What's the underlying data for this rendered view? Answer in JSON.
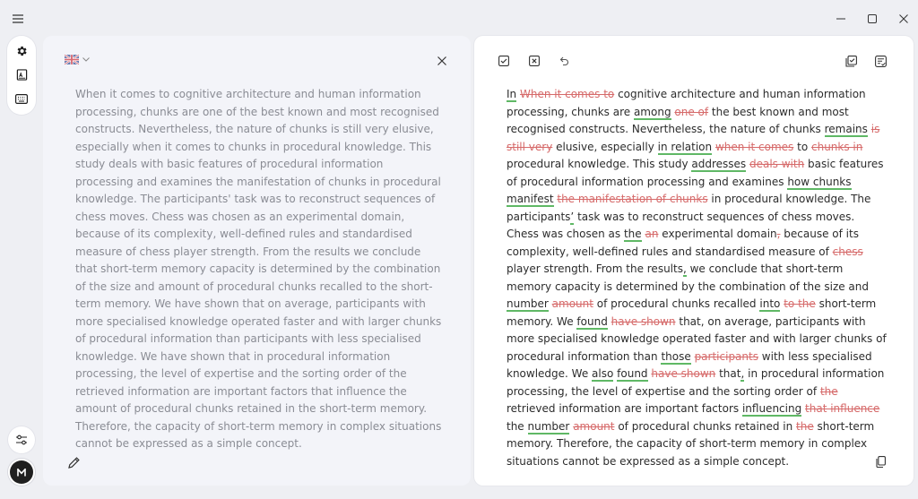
{
  "source": {
    "text": "When it comes to cognitive architecture and human information processing, chunks are one of the best known and most recognised constructs. Nevertheless, the nature of chunks is still very elusive, especially when it comes to chunks in procedural knowledge. This study deals with basic features of procedural information processing and examines the manifestation of chunks in procedural knowledge. The participants' task was to reconstruct sequences of chess moves. Chess was chosen as an experimental domain, because of its complexity, well-defined rules and standardised measure of chess player strength. From the results we conclude that short-term memory capacity is determined by the combination of the size and amount of procedural chunks recalled to the short-term memory. We have shown that on average, participants with more specialised knowledge operated faster and with larger chunks of procedural information than participants with less specialised knowledge. We have shown that in procedural information processing, the level of expertise and the sorting order of the retrieved information are important factors that influence the amount of procedural chunks retained in the short-term memory. Therefore, the capacity of short-term memory in complex situations cannot be expressed as a simple concept."
  },
  "output": {
    "segments": [
      {
        "t": "ins",
        "s": "In"
      },
      {
        "t": "n",
        "s": " "
      },
      {
        "t": "del",
        "s": "When it comes to"
      },
      {
        "t": "n",
        "s": " cognitive architecture and human information processing, chunks are "
      },
      {
        "t": "ins",
        "s": "among"
      },
      {
        "t": "n",
        "s": " "
      },
      {
        "t": "del",
        "s": "one of"
      },
      {
        "t": "n",
        "s": " the best known and most recognised constructs. Nevertheless, the nature of chunks "
      },
      {
        "t": "ins",
        "s": "remains"
      },
      {
        "t": "n",
        "s": " "
      },
      {
        "t": "del",
        "s": "is still very"
      },
      {
        "t": "n",
        "s": " elusive, especially "
      },
      {
        "t": "ins",
        "s": "in relation"
      },
      {
        "t": "n",
        "s": " "
      },
      {
        "t": "del",
        "s": "when it comes"
      },
      {
        "t": "n",
        "s": " to "
      },
      {
        "t": "del",
        "s": "chunks in"
      },
      {
        "t": "n",
        "s": " procedural knowledge. This study "
      },
      {
        "t": "ins",
        "s": "addresses"
      },
      {
        "t": "n",
        "s": " "
      },
      {
        "t": "del",
        "s": "deals with"
      },
      {
        "t": "n",
        "s": " basic features of procedural information processing and examines "
      },
      {
        "t": "ins",
        "s": "how chunks manifest"
      },
      {
        "t": "n",
        "s": " "
      },
      {
        "t": "del",
        "s": "the manifestation of chunks"
      },
      {
        "t": "n",
        "s": " in procedural knowledge. The participants"
      },
      {
        "t": "ins",
        "s": "’"
      },
      {
        "t": "n",
        "s": " task was to reconstruct sequences of chess moves. Chess was chosen as "
      },
      {
        "t": "ins",
        "s": "the"
      },
      {
        "t": "n",
        "s": " "
      },
      {
        "t": "del",
        "s": "an"
      },
      {
        "t": "n",
        "s": " experimental domain"
      },
      {
        "t": "del",
        "s": ","
      },
      {
        "t": "n",
        "s": " because of its complexity, well-defined rules and standardised measure of "
      },
      {
        "t": "del",
        "s": "chess"
      },
      {
        "t": "n",
        "s": " player strength. From the results"
      },
      {
        "t": "ins",
        "s": ","
      },
      {
        "t": "n",
        "s": " we conclude that short-term memory capacity is determined by the combination of the size and "
      },
      {
        "t": "ins",
        "s": "number"
      },
      {
        "t": "n",
        "s": " "
      },
      {
        "t": "del",
        "s": "amount"
      },
      {
        "t": "n",
        "s": " of procedural chunks recalled "
      },
      {
        "t": "ins",
        "s": "into"
      },
      {
        "t": "n",
        "s": " "
      },
      {
        "t": "del",
        "s": "to the"
      },
      {
        "t": "n",
        "s": " short-term memory. We "
      },
      {
        "t": "ins",
        "s": "found"
      },
      {
        "t": "n",
        "s": " "
      },
      {
        "t": "del",
        "s": "have shown"
      },
      {
        "t": "n",
        "s": " that, on average, participants with more specialised knowledge operated faster and with larger chunks of procedural information than "
      },
      {
        "t": "ins",
        "s": "those"
      },
      {
        "t": "n",
        "s": " "
      },
      {
        "t": "del",
        "s": "participants"
      },
      {
        "t": "n",
        "s": " with less specialised knowledge. We "
      },
      {
        "t": "ins",
        "s": "also"
      },
      {
        "t": "n",
        "s": " "
      },
      {
        "t": "ins",
        "s": "found"
      },
      {
        "t": "n",
        "s": " "
      },
      {
        "t": "del",
        "s": "have shown"
      },
      {
        "t": "n",
        "s": " that"
      },
      {
        "t": "ins",
        "s": ","
      },
      {
        "t": "n",
        "s": " in procedural information processing, the level of expertise and the sorting order of "
      },
      {
        "t": "del",
        "s": "the"
      },
      {
        "t": "n",
        "s": " retrieved information are important factors "
      },
      {
        "t": "ins",
        "s": "influencing"
      },
      {
        "t": "n",
        "s": " "
      },
      {
        "t": "del",
        "s": "that influence"
      },
      {
        "t": "n",
        "s": " the "
      },
      {
        "t": "ins",
        "s": "number"
      },
      {
        "t": "n",
        "s": " "
      },
      {
        "t": "del",
        "s": "amount"
      },
      {
        "t": "n",
        "s": " of procedural chunks retained in "
      },
      {
        "t": "del",
        "s": "the"
      },
      {
        "t": "n",
        "s": " short-term memory. Therefore, the capacity of short-term memory in complex situations cannot be expressed as a simple concept."
      }
    ]
  },
  "icons": {
    "menu": "hamburger-icon",
    "settings": "gear-icon",
    "language": "uk-flag-icon"
  },
  "colors": {
    "insert_underline": "#5fb865",
    "delete_text": "#d66a6a",
    "source_text": "#8a8c94"
  }
}
